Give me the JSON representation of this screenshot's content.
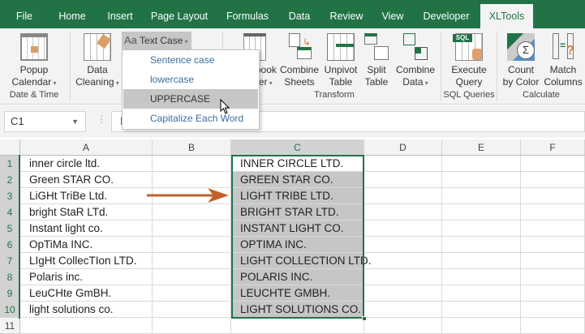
{
  "tabs": [
    "File",
    "Home",
    "Insert",
    "Page Layout",
    "Formulas",
    "Data",
    "Review",
    "View",
    "Developer",
    "XLTools"
  ],
  "active_tab": "XLTools",
  "ribbon": {
    "popup_calendar": "Popup",
    "popup_calendar2": "Calendar",
    "data_cleaning": "Data",
    "data_cleaning2": "Cleaning",
    "text_case": "Text Case",
    "text_case_icon": "Aa",
    "workbook_splitter": "Workbook",
    "workbook_splitter2": "Splitter",
    "combine_sheets": "Combine",
    "combine_sheets2": "Sheets",
    "unpivot": "Unpivot",
    "unpivot2": "Table",
    "split": "Split",
    "split2": "Table",
    "combine_data": "Combine",
    "combine_data2": "Data",
    "execute": "Execute",
    "execute2": "Query",
    "sql_badge": "SQL",
    "count": "Count",
    "count2": "by Color",
    "match": "Match",
    "match2": "Columns",
    "groups": {
      "date_time": "Date & Time",
      "transform": "Transform",
      "sql": "SQL Queries",
      "calculate": "Calculate"
    }
  },
  "text_case_menu": {
    "items": [
      "Sentence case",
      "lowercase",
      "UPPERCASE",
      "Capitalize Each Word"
    ],
    "highlighted": "UPPERCASE"
  },
  "name_box": "C1",
  "formula": "INNER CIRCLE LTD.",
  "columns": [
    "A",
    "B",
    "C",
    "D",
    "E",
    "F"
  ],
  "rows": [
    "1",
    "2",
    "3",
    "4",
    "5",
    "6",
    "7",
    "8",
    "9",
    "10",
    "11"
  ],
  "col_a": [
    "inner circle ltd.",
    "Green STAR CO.",
    "LiGHt TriBe Ltd.",
    "bright StaR LTd.",
    "Instant light co.",
    "OpTiMa INC.",
    "LIgHt CollecTIon LTD.",
    "Polaris inc.",
    "LeuCHte GmBH.",
    "light solutions co."
  ],
  "col_c": [
    "INNER CIRCLE LTD.",
    "GREEN STAR CO.",
    "LIGHT TRIBE LTD.",
    "BRIGHT STAR LTD.",
    "INSTANT LIGHT CO.",
    "OPTIMA INC.",
    "LIGHT COLLECTION LTD.",
    "POLARIS INC.",
    "LEUCHTE GMBH.",
    "LIGHT SOLUTIONS CO."
  ],
  "colors": {
    "excel_green": "#217346",
    "selection_fill": "#c6c6c6",
    "arrow": "#c0622a"
  }
}
